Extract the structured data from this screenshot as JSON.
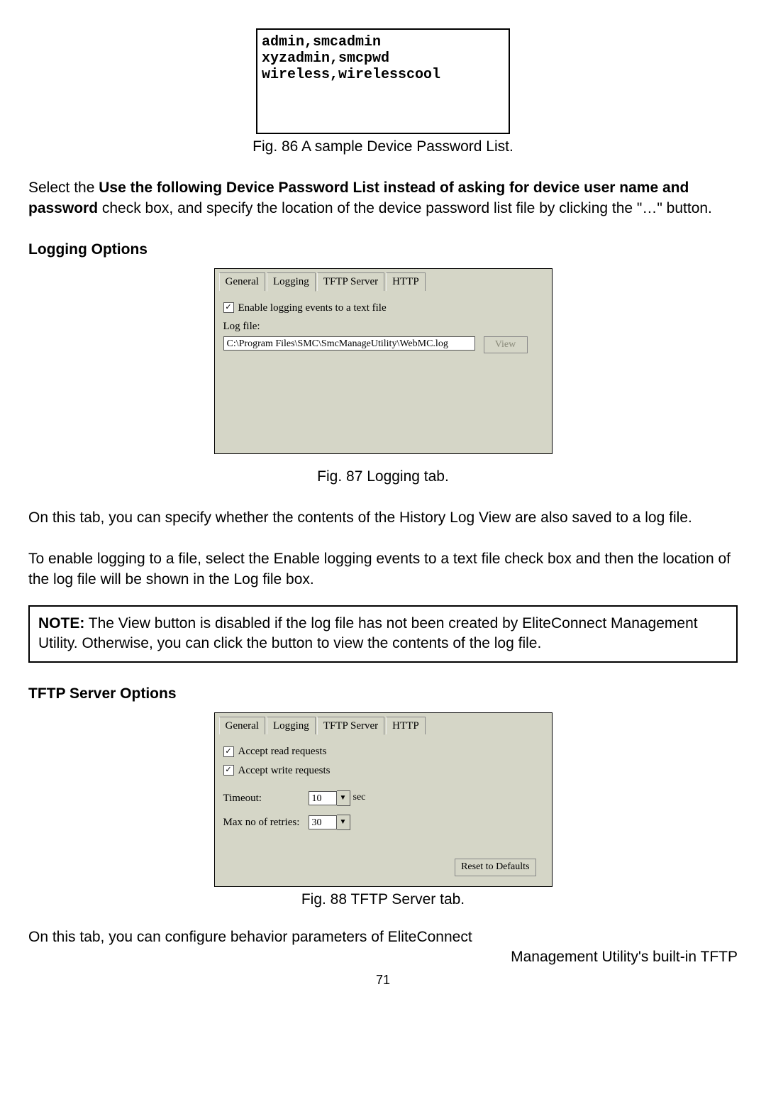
{
  "password_list_lines": "admin,smcadmin\nxyzadmin,smcpwd\nwireless,wirelesscool",
  "fig86_caption": "Fig. 86 A sample Device Password List.",
  "para1_pre": "Select the ",
  "para1_bold": "Use the following Device Password List instead of asking for device user name and password",
  "para1_post": " check box, and specify the location of the device password list file by clicking the \"…\" button.",
  "heading_logging": "Logging Options",
  "logging_tabs": {
    "general": "General",
    "logging": "Logging",
    "tftp": "TFTP Server",
    "http": "HTTP"
  },
  "logging_checkbox_label": "Enable logging events to a text file",
  "logfile_label": "Log file:",
  "logfile_value": "C:\\Program Files\\SMC\\SmcManageUtility\\WebMC.log",
  "view_button": "View",
  "fig87_caption": "Fig. 87 Logging tab.",
  "para2": "On this tab, you can specify whether the contents of the History Log View are also saved to a log file.",
  "para3": "To enable logging to a file, select the Enable logging events to a text file check box and then the location of the log file will be shown in the Log file box.",
  "note_label": "NOTE:",
  "note_text": " The View button is disabled if the log file has not been created by EliteConnect Management Utility. Otherwise, you can click the button to view the contents of the log file.",
  "heading_tftp": "TFTP Server Options",
  "tftp_accept_read": "Accept read requests",
  "tftp_accept_write": "Accept write requests",
  "tftp_timeout_label": "Timeout:",
  "tftp_timeout_value": "10",
  "tftp_timeout_unit": "sec",
  "tftp_retries_label": "Max no of retries:",
  "tftp_retries_value": "30",
  "reset_button": "Reset to Defaults",
  "fig88_caption": "Fig. 88 TFTP Server tab.",
  "para4_line1": "On this tab, you can configure behavior parameters of EliteConnect",
  "para4_line2": "Management Utility's built-in TFTP",
  "page_number": "71"
}
